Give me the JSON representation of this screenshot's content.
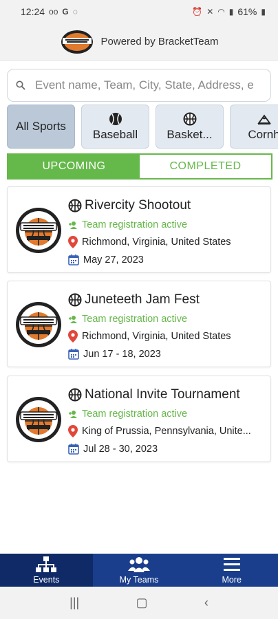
{
  "status_bar": {
    "time": "12:24",
    "battery": "61%"
  },
  "header": {
    "powered_by": "Powered by BracketTeam"
  },
  "search": {
    "placeholder": "Event name, Team, City, State, Address, e"
  },
  "sports": [
    {
      "label": "All Sports",
      "icon": "none",
      "active": true
    },
    {
      "label": "Baseball",
      "icon": "baseball-icon",
      "active": false
    },
    {
      "label": "Basket...",
      "icon": "basketball-icon",
      "active": false
    },
    {
      "label": "Cornh",
      "icon": "cornhole-icon",
      "active": false
    }
  ],
  "tabs": {
    "upcoming": "UPCOMING",
    "completed": "COMPLETED"
  },
  "events": [
    {
      "title": "Rivercity Shootout",
      "status": "Team registration active",
      "location": "Richmond, Virginia, United States",
      "date": "May 27, 2023"
    },
    {
      "title": "Juneteeth Jam Fest",
      "status": "Team registration active",
      "location": "Richmond, Virginia, United States",
      "date": "Jun 17 - 18, 2023"
    },
    {
      "title": "National Invite Tournament",
      "status": "Team registration active",
      "location": "King of Prussia, Pennsylvania, Unite...",
      "date": "Jul 28 - 30, 2023"
    }
  ],
  "nav": {
    "events": "Events",
    "my_teams": "My Teams",
    "more": "More"
  },
  "colors": {
    "accent_green": "#65b84a",
    "nav_blue": "#1a3e8c",
    "location_red": "#e2473a",
    "calendar_blue": "#3a63b8"
  }
}
